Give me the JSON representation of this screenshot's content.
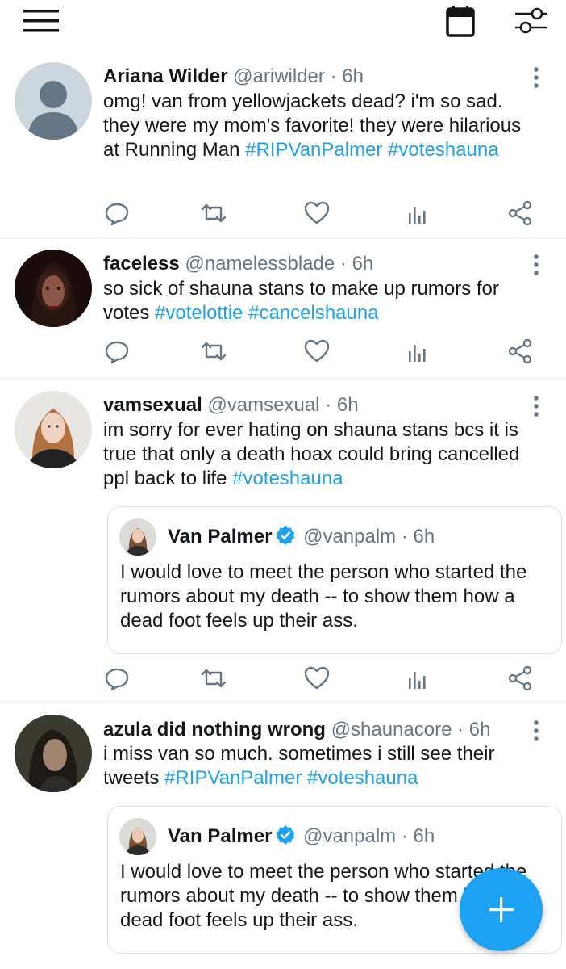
{
  "app": {
    "icons": {
      "menu": "menu-icon",
      "calendar": "calendar-icon",
      "filter": "filter-sliders-icon",
      "compose": "plus-icon"
    },
    "colors": {
      "accent": "#1da1f2",
      "secondary_text": "#657786",
      "divider": "#e6ecf0"
    }
  },
  "tweets": [
    {
      "name": "Ariana Wilder",
      "handle": "@ariwilder",
      "dot": "·",
      "time": "6h",
      "text_parts": [
        "omg! van from yellowjackets dead? i'm so sad. they were my mom's favorite! they were hilarious at Running Man "
      ],
      "hashtags": [
        "#RIPVanPalmer",
        "#voteshauna"
      ]
    },
    {
      "name": "faceless",
      "handle": "@namelessblade",
      "dot": "·",
      "time": "6h",
      "text_parts": [
        "so sick of shauna stans to make up rumors for votes "
      ],
      "hashtags": [
        "#votelottie",
        "#cancelshauna"
      ]
    },
    {
      "name": "vamsexual",
      "handle": "@vamsexual",
      "dot": "·",
      "time": "6h",
      "text_parts": [
        "im sorry for ever hating on shauna stans bcs it is true that only a death hoax could bring cancelled ppl back to life "
      ],
      "hashtags": [
        "#voteshauna"
      ],
      "quote": {
        "name": "Van Palmer",
        "handle": "@vanpalm",
        "dot": "·",
        "time": "6h",
        "text": "I would love to meet the person who started the rumors about my death -- to show them how a dead foot feels up their ass."
      }
    },
    {
      "name": "azula did nothing wrong",
      "handle": "@shaunacore",
      "dot": "·",
      "time": "6h",
      "text_parts": [
        "i miss van so much. sometimes i still see their tweets "
      ],
      "hashtags": [
        "#RIPVanPalmer",
        "#voteshauna"
      ],
      "quote": {
        "name": "Van Palmer",
        "handle": "@vanpalm",
        "dot": "·",
        "time": "6h",
        "text": "I would love to meet the person who started the rumors about my death -- to show them how a dead foot feels up their ass."
      }
    }
  ]
}
